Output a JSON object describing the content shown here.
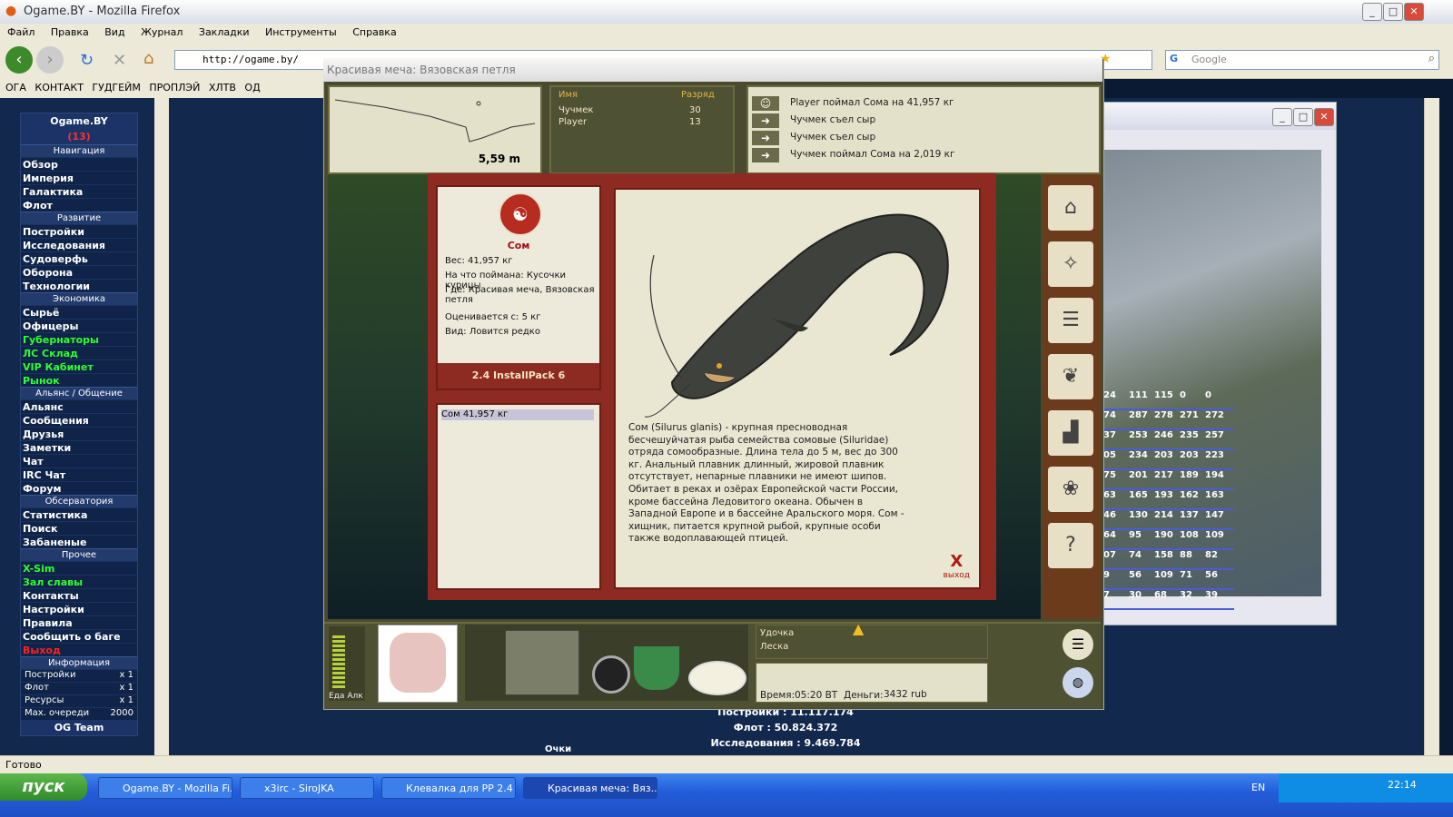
{
  "browser": {
    "title": "Ogame.BY - Mozilla Firefox",
    "menu": [
      "Файл",
      "Правка",
      "Вид",
      "Журнал",
      "Закладки",
      "Инструменты",
      "Справка"
    ],
    "url": "http://ogame.by/",
    "search_placeholder": "Google",
    "bookmarks": [
      "ОГА",
      "КОНТАКТ",
      "ГУДГЕЙМ",
      "ПРОПЛЭЙ",
      "ХЛТВ",
      "ОД"
    ],
    "status": "Готово"
  },
  "ogame": {
    "title": "Ogame.BY",
    "badge": "(13)",
    "sections": [
      {
        "header": "Навигация",
        "items": [
          {
            "label": "Обзор",
            "style": "white"
          },
          {
            "label": "Империя",
            "style": "white"
          },
          {
            "label": "Галактика",
            "style": "white"
          },
          {
            "label": "Флот",
            "style": "white"
          }
        ]
      },
      {
        "header": "Развитие",
        "items": [
          {
            "label": "Постройки",
            "style": "white"
          },
          {
            "label": "Исследования",
            "style": "white"
          },
          {
            "label": "Судоверфь",
            "style": "white"
          },
          {
            "label": "Оборона",
            "style": "white"
          },
          {
            "label": "Технологии",
            "style": "white"
          }
        ]
      },
      {
        "header": "Экономика",
        "items": [
          {
            "label": "Сырьё",
            "style": "white"
          },
          {
            "label": "Офицеры",
            "style": "white"
          },
          {
            "label": "Губернаторы",
            "style": "green"
          },
          {
            "label": "ЛС Склад",
            "style": "green"
          },
          {
            "label": "VIP Кабинет",
            "style": "green"
          },
          {
            "label": "Рынок",
            "style": "green"
          }
        ]
      },
      {
        "header": "Альянс / Общение",
        "items": [
          {
            "label": "Альянс",
            "style": "white"
          },
          {
            "label": "Сообщения",
            "style": "white"
          },
          {
            "label": "Друзья",
            "style": "white"
          },
          {
            "label": "Заметки",
            "style": "white"
          },
          {
            "label": "Чат",
            "style": "white"
          },
          {
            "label": "IRC Чат",
            "style": "white"
          },
          {
            "label": "Форум",
            "style": "white"
          }
        ]
      },
      {
        "header": "Обсерватория",
        "items": [
          {
            "label": "Статистика",
            "style": "white"
          },
          {
            "label": "Поиск",
            "style": "white"
          },
          {
            "label": "Забаненые",
            "style": "white"
          }
        ]
      },
      {
        "header": "Прочее",
        "items": [
          {
            "label": "X-Sim",
            "style": "green"
          },
          {
            "label": "Зал славы",
            "style": "green"
          },
          {
            "label": "Контакты",
            "style": "white"
          },
          {
            "label": "Настройки",
            "style": "white"
          },
          {
            "label": "Правила",
            "style": "white"
          },
          {
            "label": "Сообщить о баге",
            "style": "white"
          },
          {
            "label": "Выход",
            "style": "red"
          }
        ]
      }
    ],
    "info_header": "Информация",
    "info": [
      {
        "label": "Постройки",
        "value": "x 1"
      },
      {
        "label": "Флот",
        "value": "x 1"
      },
      {
        "label": "Ресурсы",
        "value": "x 1"
      },
      {
        "label": "Max. очереди",
        "value": "2000"
      }
    ],
    "team": "OG Team",
    "stats": [
      "Постройки : 11.117.174",
      "Флот : 50.824.372",
      "Исследования : 9.469.784"
    ],
    "bottom_label": "Очки"
  },
  "game": {
    "window_title": "Красивая меча: Вязовская петля",
    "depth": "5,59 m",
    "players_header": {
      "name": "Имя",
      "rank": "Разряд"
    },
    "players": [
      {
        "name": "Чучмек",
        "rank": "30"
      },
      {
        "name": "Player",
        "rank": "13"
      }
    ],
    "log": [
      "Player поймал Сома на 41,957 кг",
      "Чучмек съел сыр",
      "Чучмек съел сыр",
      "Чучмек поймал Сома на 2,019 кг"
    ],
    "fish": {
      "name": "Сом",
      "weight": "Вес: 41,957 кг",
      "bait": "На что поймана: Кусочки курицы",
      "place": "Где: Красивая меча, Вязовская петля",
      "valued": "Оценивается с: 5 кг",
      "kind": "Вид: Ловится редко",
      "pack": "2.4 InstallPack 6",
      "list_item": "Сом 41,957 кг",
      "description": "Сом (Silurus glanis) - крупная пресноводная бесчешуйчатая рыба семейства сомовые (Siluridae) отряда сомообразные. Длина тела до 5 м, вес до 300 кг. Анальный плавник длинный, жировой плавник отсутствует, непарные плавники не имеют шипов. Обитает в реках и озёрах Европейской части России, кроме бассейна Ледовитого океана. Обычен в Западной Европе и в бассейне Аральского моря. Сом - хищник, питается крупной рыбой, крупные особи также водоплавающей птицей.",
      "exit_label": "выход"
    },
    "hud": {
      "food_label": "Еда",
      "alc_label": "Алк",
      "rod_label": "Удочка",
      "line_label": "Леска",
      "time_label": "Время:",
      "time": "05:20 ВТ",
      "money_label": "Деньги:",
      "money": "3432 rub"
    },
    "right_icons": [
      "house-icon",
      "compass-icon",
      "chat-icon",
      "laurel-icon",
      "podium-icon",
      "grapes-icon",
      "help-icon"
    ]
  },
  "bg_grid": [
    [
      "24",
      "111",
      "115",
      "0",
      "0"
    ],
    [
      "74",
      "287",
      "278",
      "271",
      "272"
    ],
    [
      "37",
      "253",
      "246",
      "235",
      "257"
    ],
    [
      "05",
      "234",
      "203",
      "203",
      "223"
    ],
    [
      "75",
      "201",
      "217",
      "189",
      "194"
    ],
    [
      "63",
      "165",
      "193",
      "162",
      "163"
    ],
    [
      "46",
      "130",
      "214",
      "137",
      "147"
    ],
    [
      "64",
      "95",
      "190",
      "108",
      "109"
    ],
    [
      "07",
      "74",
      "158",
      "88",
      "82"
    ],
    [
      "9",
      "56",
      "109",
      "71",
      "56"
    ],
    [
      "7",
      "30",
      "68",
      "32",
      "39"
    ]
  ],
  "taskbar": {
    "start": "пуск",
    "tasks": [
      "Ogame.BY - Mozilla Fi...",
      "x3irc - SiroJKA",
      "Клевалка для РР 2.4",
      "Красивая меча: Вяз..."
    ],
    "lang": "EN",
    "clock": "22:14"
  }
}
